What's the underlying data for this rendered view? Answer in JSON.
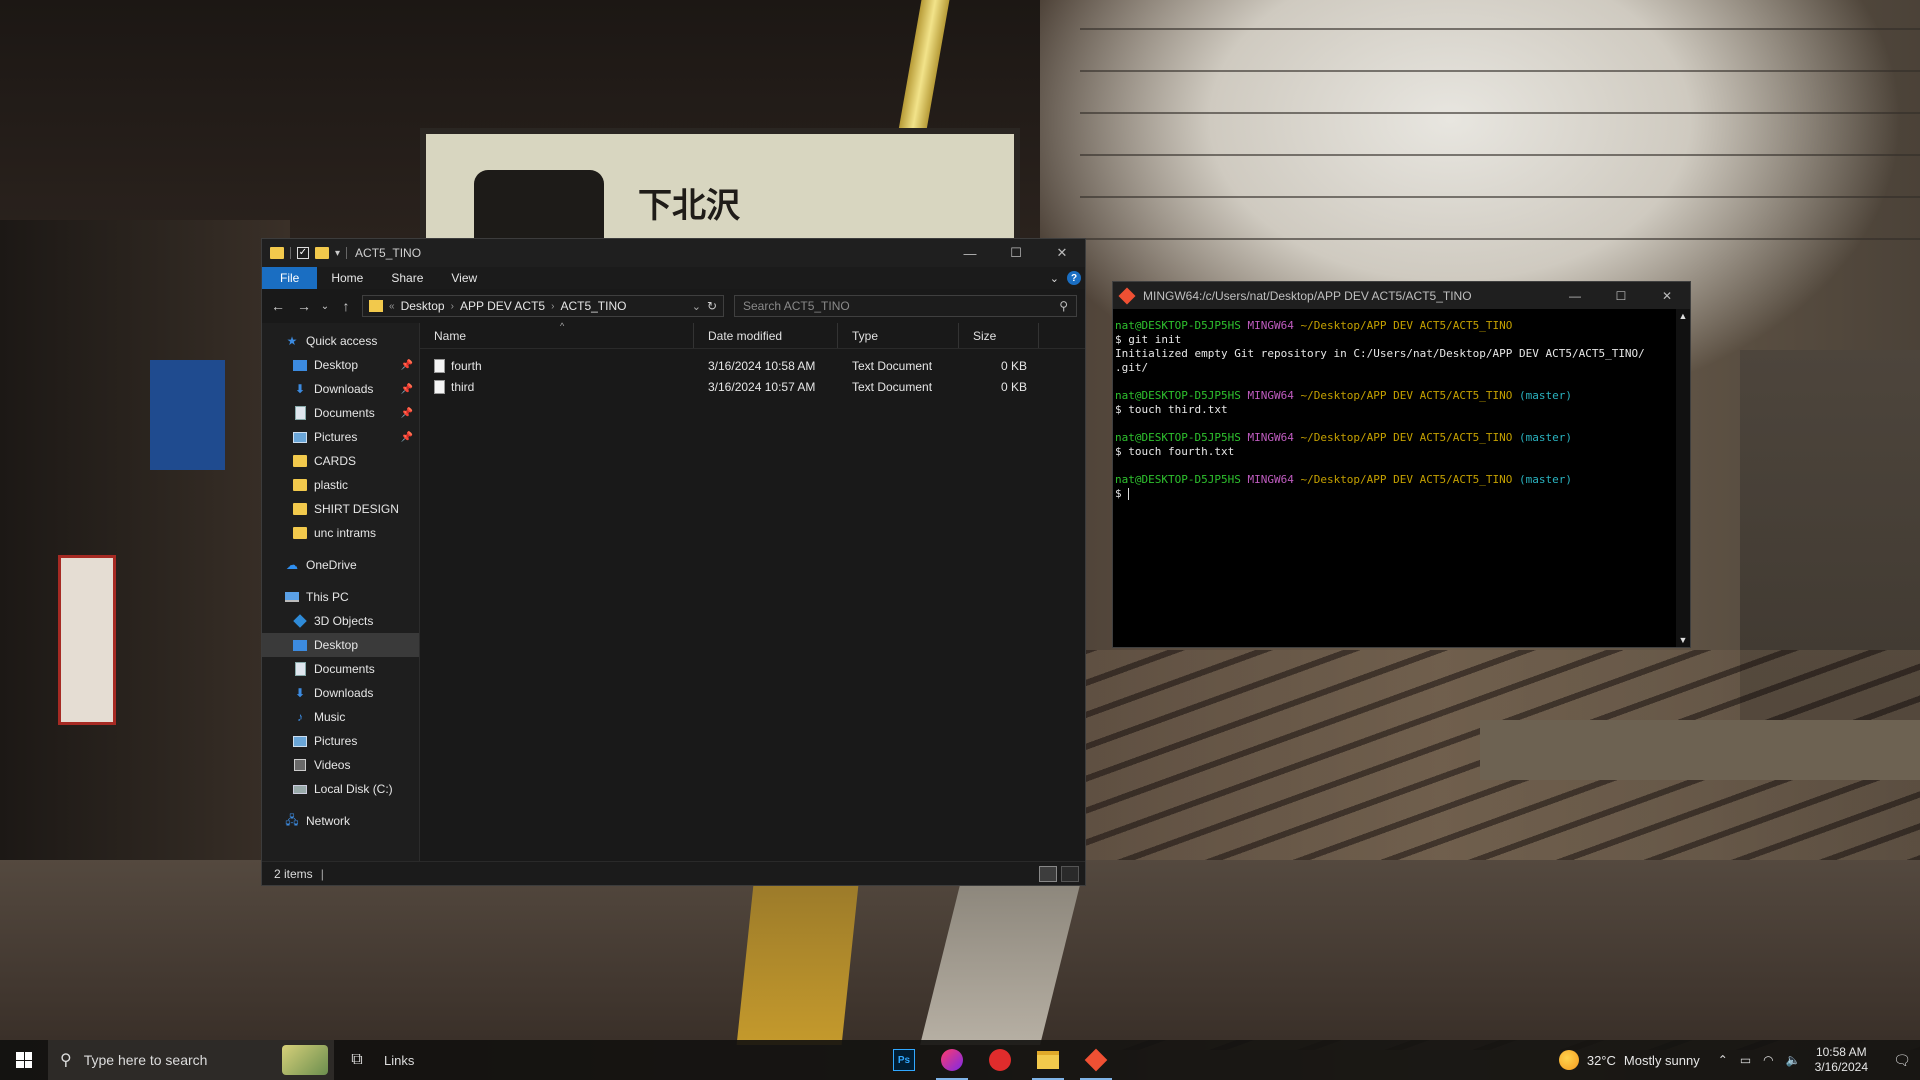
{
  "explorer": {
    "title": "ACT5_TINO",
    "ribbon_tabs": [
      "File",
      "Home",
      "Share",
      "View"
    ],
    "breadcrumb": [
      "Desktop",
      "APP DEV ACT5",
      "ACT5_TINO"
    ],
    "search_placeholder": "Search ACT5_TINO",
    "nav": {
      "quick_access": "Quick access",
      "quick_items": [
        {
          "label": "Desktop",
          "icon": "desktop-icon",
          "pinned": true
        },
        {
          "label": "Downloads",
          "icon": "download-icon",
          "pinned": true
        },
        {
          "label": "Documents",
          "icon": "documents-icon",
          "pinned": true
        },
        {
          "label": "Pictures",
          "icon": "pictures-icon",
          "pinned": true
        },
        {
          "label": "CARDS",
          "icon": "folder-icon",
          "pinned": false
        },
        {
          "label": "plastic",
          "icon": "folder-icon",
          "pinned": false
        },
        {
          "label": "SHIRT DESIGN",
          "icon": "folder-icon",
          "pinned": false
        },
        {
          "label": "unc intrams",
          "icon": "folder-icon",
          "pinned": false
        }
      ],
      "onedrive": "OneDrive",
      "this_pc": "This PC",
      "pc_items": [
        {
          "label": "3D Objects",
          "icon": "cube-icon"
        },
        {
          "label": "Desktop",
          "icon": "desktop-icon",
          "selected": true
        },
        {
          "label": "Documents",
          "icon": "documents-icon"
        },
        {
          "label": "Downloads",
          "icon": "download-icon"
        },
        {
          "label": "Music",
          "icon": "music-icon"
        },
        {
          "label": "Pictures",
          "icon": "pictures-icon"
        },
        {
          "label": "Videos",
          "icon": "videos-icon"
        },
        {
          "label": "Local Disk (C:)",
          "icon": "disk-icon"
        }
      ],
      "network": "Network"
    },
    "columns": {
      "name": "Name",
      "date": "Date modified",
      "type": "Type",
      "size": "Size"
    },
    "files": [
      {
        "name": "fourth",
        "date": "3/16/2024 10:58 AM",
        "type": "Text Document",
        "size": "0 KB"
      },
      {
        "name": "third",
        "date": "3/16/2024 10:57 AM",
        "type": "Text Document",
        "size": "0 KB"
      }
    ],
    "status": "2 items"
  },
  "terminal": {
    "title": "MINGW64:/c/Users/nat/Desktop/APP DEV ACT5/ACT5_TINO",
    "user_host": "nat@DESKTOP-D5JP5HS",
    "env": "MINGW64",
    "path": "~/Desktop/APP DEV ACT5/ACT5_TINO",
    "branch": "(master)",
    "cmd1": "$ git init",
    "out1a": "Initialized empty Git repository in C:/Users/nat/Desktop/APP DEV ACT5/ACT5_TINO/",
    "out1b": ".git/",
    "cmd2": "$ touch third.txt",
    "cmd3": "$ touch fourth.txt",
    "prompt": "$ "
  },
  "taskbar": {
    "search_placeholder": "Type here to search",
    "links": "Links",
    "apps": [
      "photoshop-icon",
      "canva-icon",
      "anydesk-icon",
      "file-explorer-icon",
      "git-bash-icon"
    ],
    "weather_temp": "32°C",
    "weather_text": "Mostly sunny",
    "time": "10:58 AM",
    "date": "3/16/2024"
  },
  "wallpaper": {
    "sign_text": "下北沢"
  },
  "colors": {
    "accent": "#1a6ec2",
    "term_green": "#2ec12e",
    "term_purple": "#c05cc0",
    "term_yellow": "#c4a000",
    "term_cyan": "#2ab3c0"
  }
}
